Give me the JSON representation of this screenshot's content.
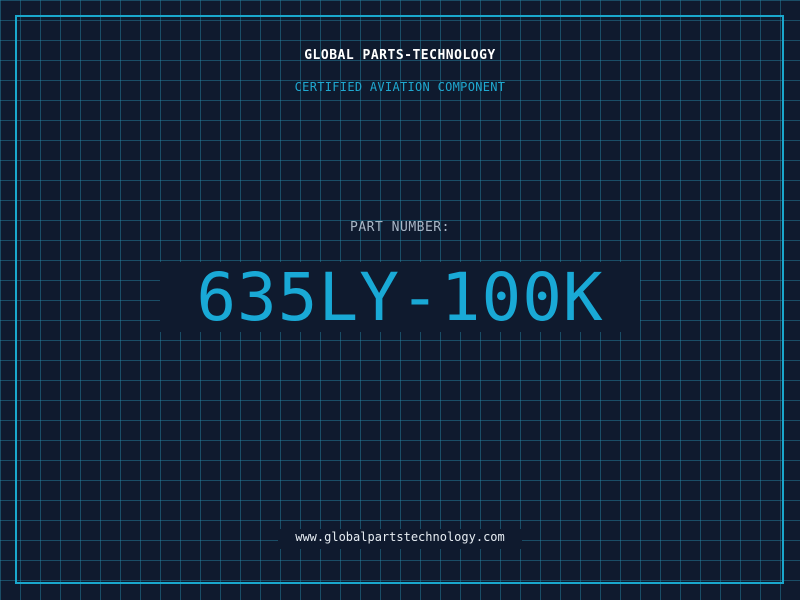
{
  "header": {
    "company": "GLOBAL PARTS-TECHNOLOGY",
    "tagline": "CERTIFIED AVIATION COMPONENT"
  },
  "part": {
    "label": "PART NUMBER:",
    "number": "635LY-100K"
  },
  "footer": {
    "website": "www.globalpartstechnology.com"
  },
  "colors": {
    "background": "#0f1a2e",
    "grid": "#288caa",
    "frame": "#1aa7cc",
    "accent": "#19a9d6",
    "label": "#a9b6c6",
    "title": "#ffffff"
  }
}
